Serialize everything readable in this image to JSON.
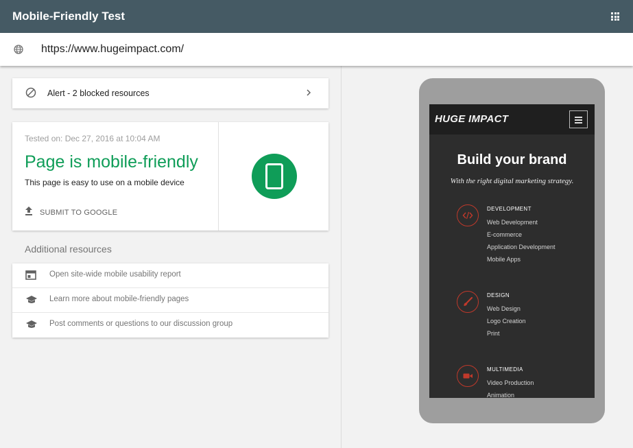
{
  "appbar": {
    "title": "Mobile-Friendly Test",
    "apps_icon": "apps-grid-icon"
  },
  "urlbar": {
    "icon": "globe-icon",
    "url": "https://www.hugeimpact.com/"
  },
  "alert": {
    "icon": "block-icon",
    "text": "Alert - 2 blocked resources",
    "chevron": "chevron-right-icon"
  },
  "result": {
    "tested_on": "Tested on: Dec 27, 2016 at 10:04 AM",
    "verdict": "Page is mobile-friendly",
    "description": "This page is easy to use on a mobile device",
    "submit_label": "SUBMIT TO GOOGLE",
    "badge_icon": "smartphone-icon",
    "verdict_color": "#0f9d58"
  },
  "additional": {
    "heading": "Additional resources",
    "items": [
      {
        "icon": "web-report-icon",
        "label": "Open site-wide mobile usability report"
      },
      {
        "icon": "school-icon",
        "label": "Learn more about mobile-friendly pages"
      },
      {
        "icon": "school-icon",
        "label": "Post comments or questions to our discussion group"
      }
    ]
  },
  "preview": {
    "logo": "HUGE IMPACT",
    "menu_icon": "hamburger-menu-icon",
    "headline": "Build your brand",
    "tagline": "With the right digital marketing strategy.",
    "accent": "#c0392b",
    "services": [
      {
        "icon": "code-icon",
        "title": "DEVELOPMENT",
        "items": [
          "Web Development",
          "E-commerce",
          "Application Development",
          "Mobile Apps"
        ]
      },
      {
        "icon": "brush-icon",
        "title": "DESIGN",
        "items": [
          "Web Design",
          "Logo Creation",
          "Print"
        ]
      },
      {
        "icon": "video-camera-icon",
        "title": "MULTIMEDIA",
        "items": [
          "Video Production",
          "Animation"
        ]
      }
    ]
  }
}
